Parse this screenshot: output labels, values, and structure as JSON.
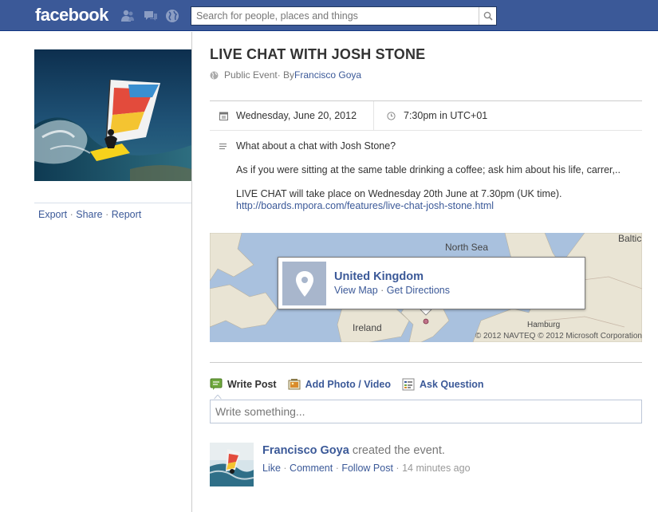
{
  "topbar": {
    "logo": "facebook",
    "search_placeholder": "Search for people, places and things",
    "icons": [
      "friend-requests-icon",
      "messages-icon",
      "notifications-globe-icon",
      "search-icon"
    ]
  },
  "left": {
    "export": "Export",
    "share": "Share",
    "report": "Report",
    "sep": " · "
  },
  "event": {
    "title": "LIVE CHAT WITH JOSH STONE",
    "privacy": "Public Event",
    "by_prefix": " · By ",
    "host": "Francisco Goya",
    "date": "Wednesday, June 20, 2012",
    "time": "7:30pm in UTC+01",
    "description": [
      "What about a chat with Josh Stone?",
      "As if you were sitting at the same table drinking a coffee; ask him about his life, carrer,..",
      "LIVE CHAT will take place on Wednesday 20th June at 7.30pm (UK time)."
    ],
    "link": "http://boards.mpora.com/features/live-chat-josh-stone.html"
  },
  "map": {
    "place": "United Kingdom",
    "view_map": "View Map",
    "sep": " · ",
    "get_directions": "Get Directions",
    "labels": {
      "north_sea": "North Sea",
      "baltic": "Baltic",
      "ireland": "Ireland",
      "hamburg": "Hamburg"
    },
    "copyright": "© 2012 NAVTEQ © 2012 Microsoft Corporation"
  },
  "composer": {
    "write_post": "Write Post",
    "add_photo": "Add Photo / Video",
    "ask_question": "Ask Question",
    "placeholder": "Write something..."
  },
  "story": {
    "actor": "Francisco Goya",
    "action": " created the event.",
    "like": "Like",
    "comment": "Comment",
    "follow": "Follow Post",
    "sep": " · ",
    "time": "14 minutes ago"
  },
  "colors": {
    "brand_blue": "#3b5998",
    "link_blue": "#3b5998",
    "map_water": "#a9c1de"
  }
}
